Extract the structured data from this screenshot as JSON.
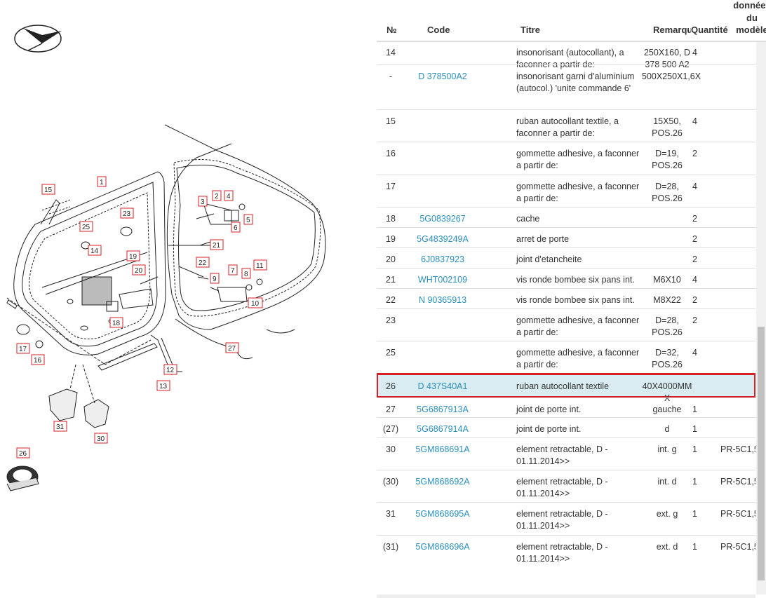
{
  "headers": {
    "no": "№",
    "code": "Code",
    "title": "Titre",
    "remarque": "Remarque",
    "quantite": "Quantité",
    "modele_1": "données",
    "modele_2": "du",
    "modele_3": "modèle"
  },
  "rows": [
    {
      "no": "14",
      "code": "",
      "title": "insonorisant (autocollant), a faconner a partir de:",
      "remark": "250X160, D 378 500 A2",
      "qty": "4",
      "model": ""
    },
    {
      "no": "-",
      "code": "D 378500A2",
      "title": "insonorisant garni d'aluminium (autocol.) 'unite commande 6'",
      "remark": "500X250X1,6X",
      "qty": "",
      "model": ""
    },
    {
      "no": "15",
      "code": "",
      "title": "ruban autocollant textile, a faconner a partir de:",
      "remark": "15X50, POS.26",
      "qty": "4",
      "model": ""
    },
    {
      "no": "16",
      "code": "",
      "title": "gommette adhesive, a faconner a partir de:",
      "remark": "D=19, POS.26",
      "qty": "2",
      "model": ""
    },
    {
      "no": "17",
      "code": "",
      "title": "gommette adhesive, a faconner a partir de:",
      "remark": "D=28, POS.26",
      "qty": "4",
      "model": ""
    },
    {
      "no": "18",
      "code": "5G0839267",
      "title": "cache",
      "remark": "",
      "qty": "2",
      "model": ""
    },
    {
      "no": "19",
      "code": "5G4839249A",
      "title": "arret de porte",
      "remark": "",
      "qty": "2",
      "model": ""
    },
    {
      "no": "20",
      "code": "6J0837923",
      "title": "joint d'etancheite",
      "remark": "",
      "qty": "2",
      "model": ""
    },
    {
      "no": "21",
      "code": "WHT002109",
      "title": "vis ronde bombee six pans int.",
      "remark": "M6X10",
      "qty": "4",
      "model": ""
    },
    {
      "no": "22",
      "code": "N 90365913",
      "title": "vis ronde bombee six pans int.",
      "remark": "M8X22",
      "qty": "2",
      "model": ""
    },
    {
      "no": "23",
      "code": "",
      "title": "gommette adhesive, a faconner a partir de:",
      "remark": "D=28, POS.26",
      "qty": "2",
      "model": ""
    },
    {
      "no": "25",
      "code": "",
      "title": "gommette adhesive, a faconner a partir de:",
      "remark": "D=32, POS.26",
      "qty": "4",
      "model": ""
    },
    {
      "no": "26",
      "code": "D 437S40A1",
      "title": "ruban autocollant textile",
      "remark": "40X4000MM X",
      "qty": "",
      "model": "",
      "selected": true
    },
    {
      "no": "27",
      "code": "5G6867913A",
      "title": "joint de porte int.",
      "remark": "gauche",
      "qty": "1",
      "model": ""
    },
    {
      "no": "(27)",
      "code": "5G6867914A",
      "title": "joint de porte int.",
      "remark": "d",
      "qty": "1",
      "model": ""
    },
    {
      "no": "30",
      "code": "5GM868691A",
      "title": "element retractable, D - 01.11.2014>>",
      "remark": "int. g",
      "qty": "1",
      "model": "PR-5C1,5"
    },
    {
      "no": "(30)",
      "code": "5GM868692A",
      "title": "element retractable, D - 01.11.2014>>",
      "remark": "int. d",
      "qty": "1",
      "model": "PR-5C1,5"
    },
    {
      "no": "31",
      "code": "5GM868695A",
      "title": "element retractable, D - 01.11.2014>>",
      "remark": "ext. g",
      "qty": "1",
      "model": "PR-5C1,5"
    },
    {
      "no": "(31)",
      "code": "5GM868696A",
      "title": "element retractable, D - 01.11.2014>>",
      "remark": "ext. d",
      "qty": "1",
      "model": "PR-5C1,5"
    }
  ],
  "diagram_callouts": [
    "1",
    "2",
    "3",
    "4",
    "5",
    "6",
    "7",
    "8",
    "9",
    "10",
    "11",
    "12",
    "13",
    "14",
    "15",
    "16",
    "17",
    "18",
    "19",
    "20",
    "21",
    "22",
    "23",
    "25",
    "26",
    "27",
    "30",
    "31"
  ],
  "colors": {
    "link": "#2a8fbd",
    "selected_bg": "#d9ecf2",
    "selected_border": "#d61f26",
    "callout_border": "#d61f26"
  },
  "icons": {
    "logo": "plane-logo-icon"
  }
}
